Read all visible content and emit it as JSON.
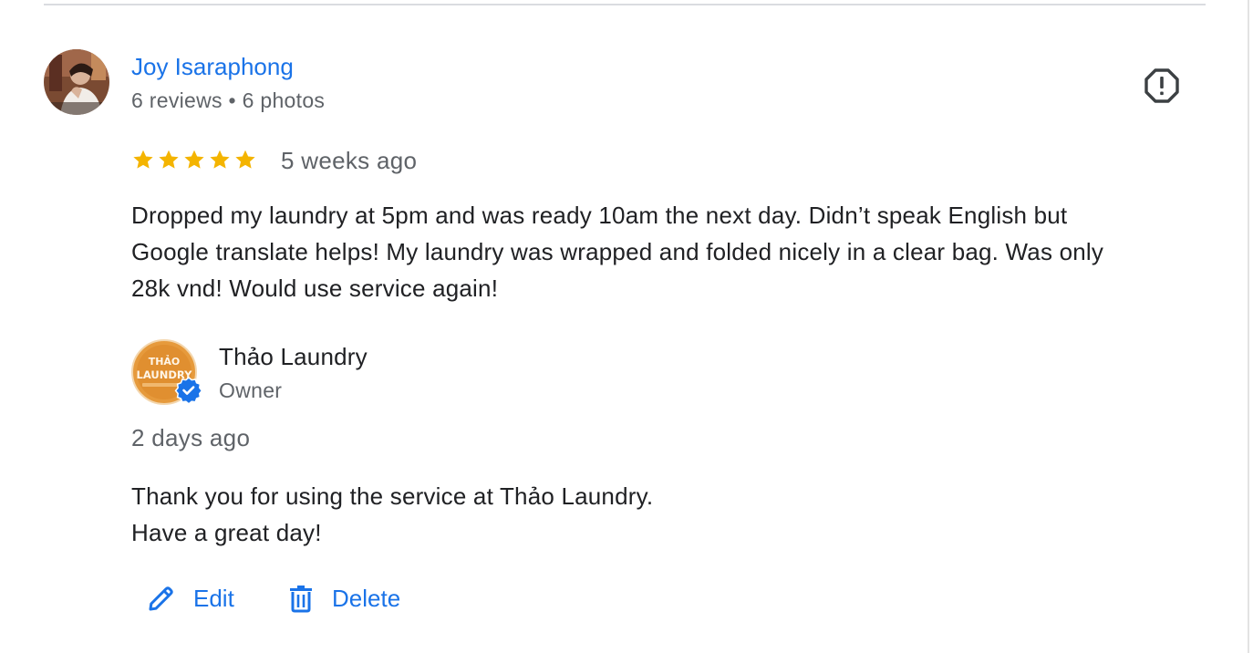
{
  "review": {
    "reviewer_name": "Joy Isaraphong",
    "reviewer_meta": "6 reviews • 6 photos",
    "rating": 5,
    "max_rating": 5,
    "date": "5 weeks ago",
    "text_lines": [
      "Dropped my laundry at 5pm and was ready 10am the next day. Didn’t speak English but",
      "Google translate helps! My laundry was wrapped and folded nicely in a clear bag. Was only",
      "28k vnd! Would use service again!"
    ],
    "report_icon": "report-octagon-icon",
    "star_color": "#f4b400"
  },
  "owner_reply": {
    "owner_name": "Thảo Laundry",
    "role": "Owner",
    "avatar_text_top": "THẢO",
    "avatar_text_bottom": "LAUNDRY",
    "date": "2 days ago",
    "text_lines": [
      "Thank you for using the service at Thảo Laundry.",
      "Have a great day!"
    ],
    "verified_icon": "verified-badge-icon",
    "avatar_color": "#e69a3c"
  },
  "actions": {
    "edit_label": "Edit",
    "delete_label": "Delete",
    "edit_icon": "pencil-icon",
    "delete_icon": "trash-icon"
  },
  "colors": {
    "link": "#1a73e8",
    "secondary_text": "#5f6368",
    "primary_text": "#202124"
  }
}
